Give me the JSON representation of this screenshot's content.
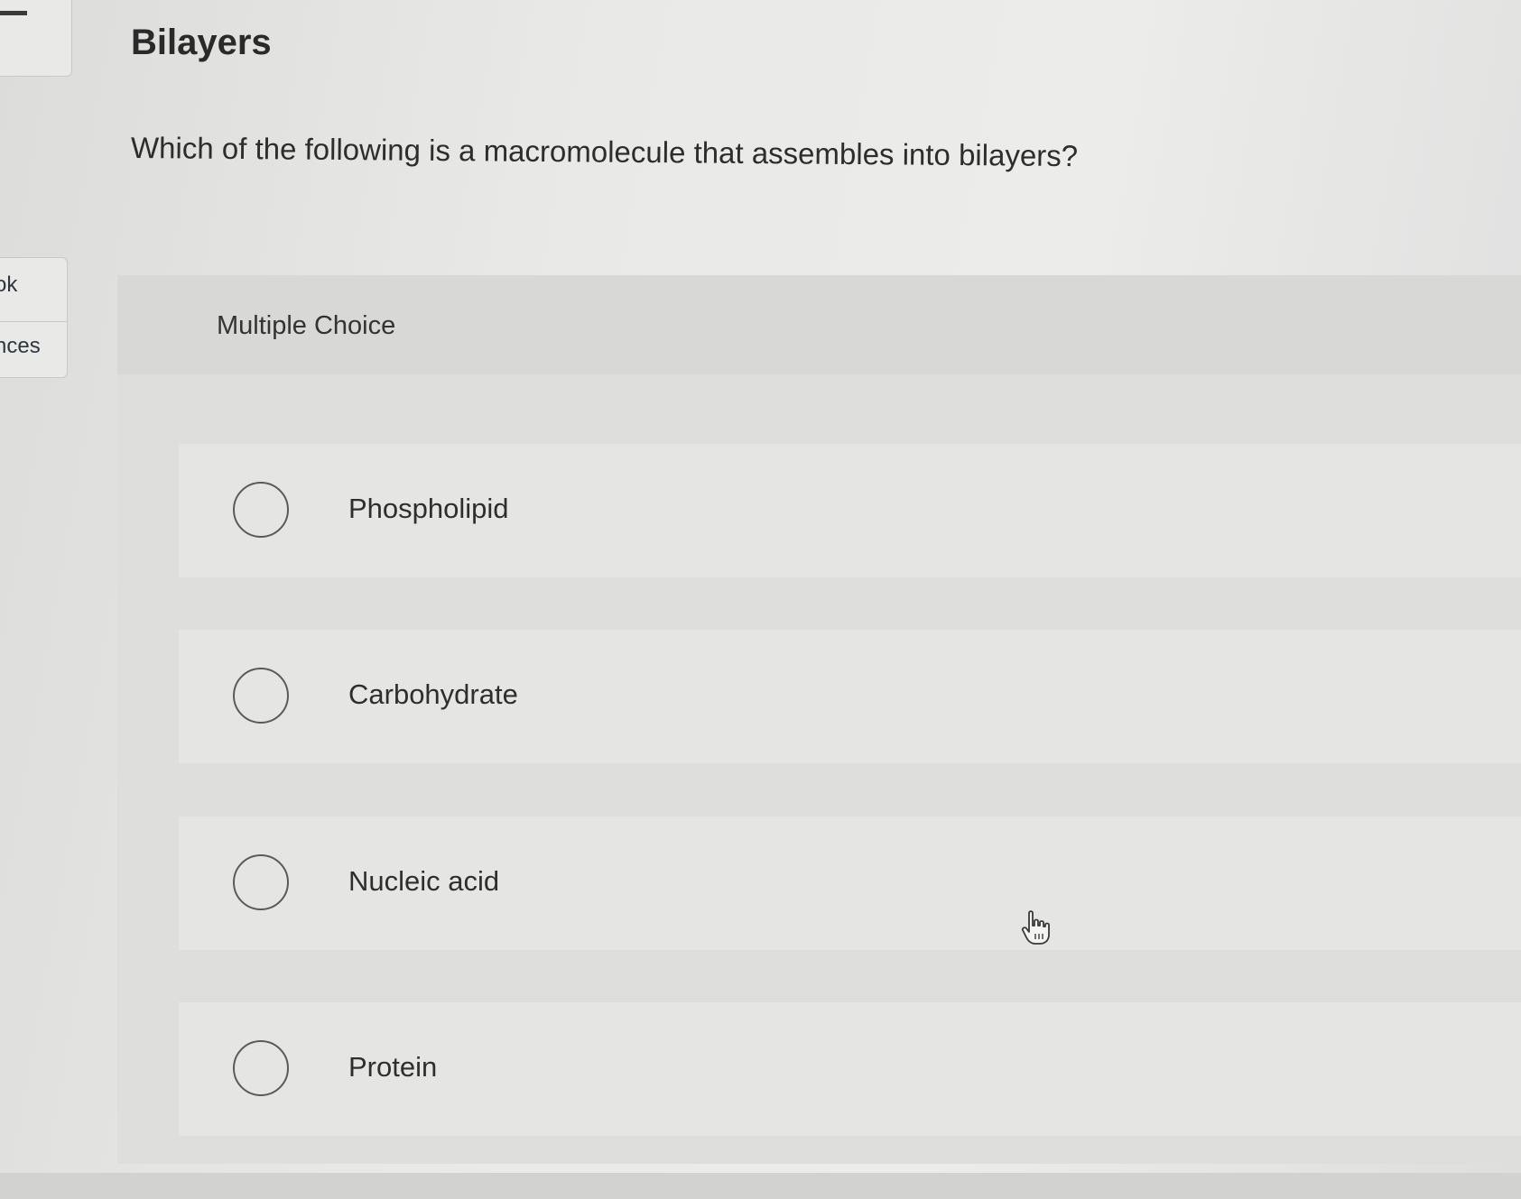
{
  "sidebar": {
    "tab_1_label": "ok",
    "tab_2_label": "nces"
  },
  "page": {
    "title": "Bilayers",
    "question": "Which of the following is a macromolecule that assembles into bilayers?"
  },
  "multiple_choice": {
    "label": "Multiple Choice",
    "options": [
      {
        "label": "Phospholipid",
        "selected": false
      },
      {
        "label": "Carbohydrate",
        "selected": false
      },
      {
        "label": "Nucleic acid",
        "selected": false
      },
      {
        "label": "Protein",
        "selected": false
      }
    ]
  },
  "icons": {
    "menu": "menu-icon",
    "radio": "radio-button-icon",
    "cursor": "hand-pointer-cursor-icon"
  }
}
